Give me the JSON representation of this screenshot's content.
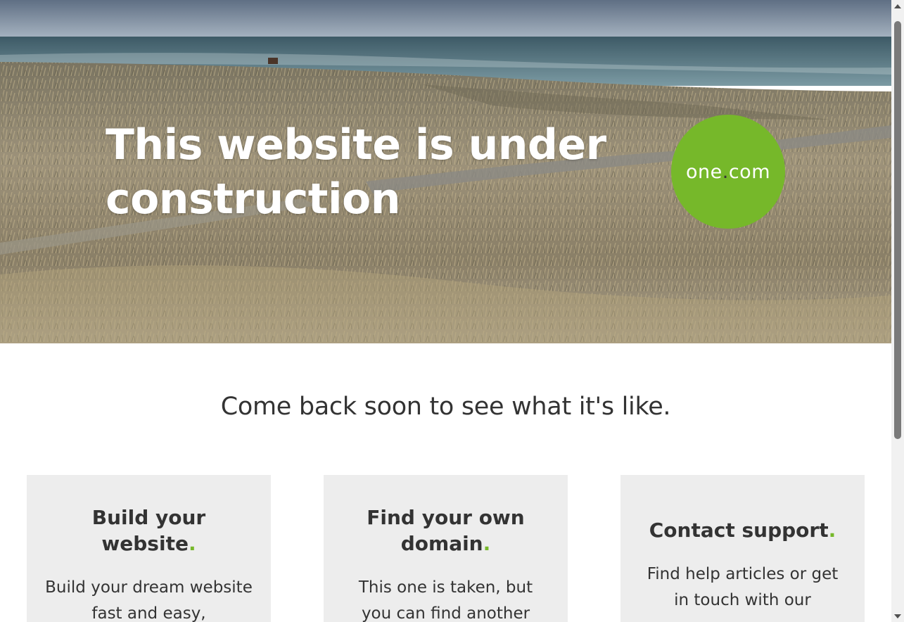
{
  "hero": {
    "title": "This website is under construction",
    "logo": {
      "prefix": "one",
      "dot": ".",
      "suffix": "com"
    }
  },
  "tagline": "Come back soon to see what it's like.",
  "cards": [
    {
      "title": "Build your website",
      "dot": ".",
      "text": "Build your dream website fast and easy,"
    },
    {
      "title": "Find your own domain",
      "dot": ".",
      "text": "This one is taken, but you can find another"
    },
    {
      "title": "Contact support",
      "dot": ".",
      "text": "Find help articles or get in touch with our"
    }
  ],
  "colors": {
    "brand_green": "#76b82a",
    "text": "#333333",
    "card_bg": "#ededed"
  }
}
